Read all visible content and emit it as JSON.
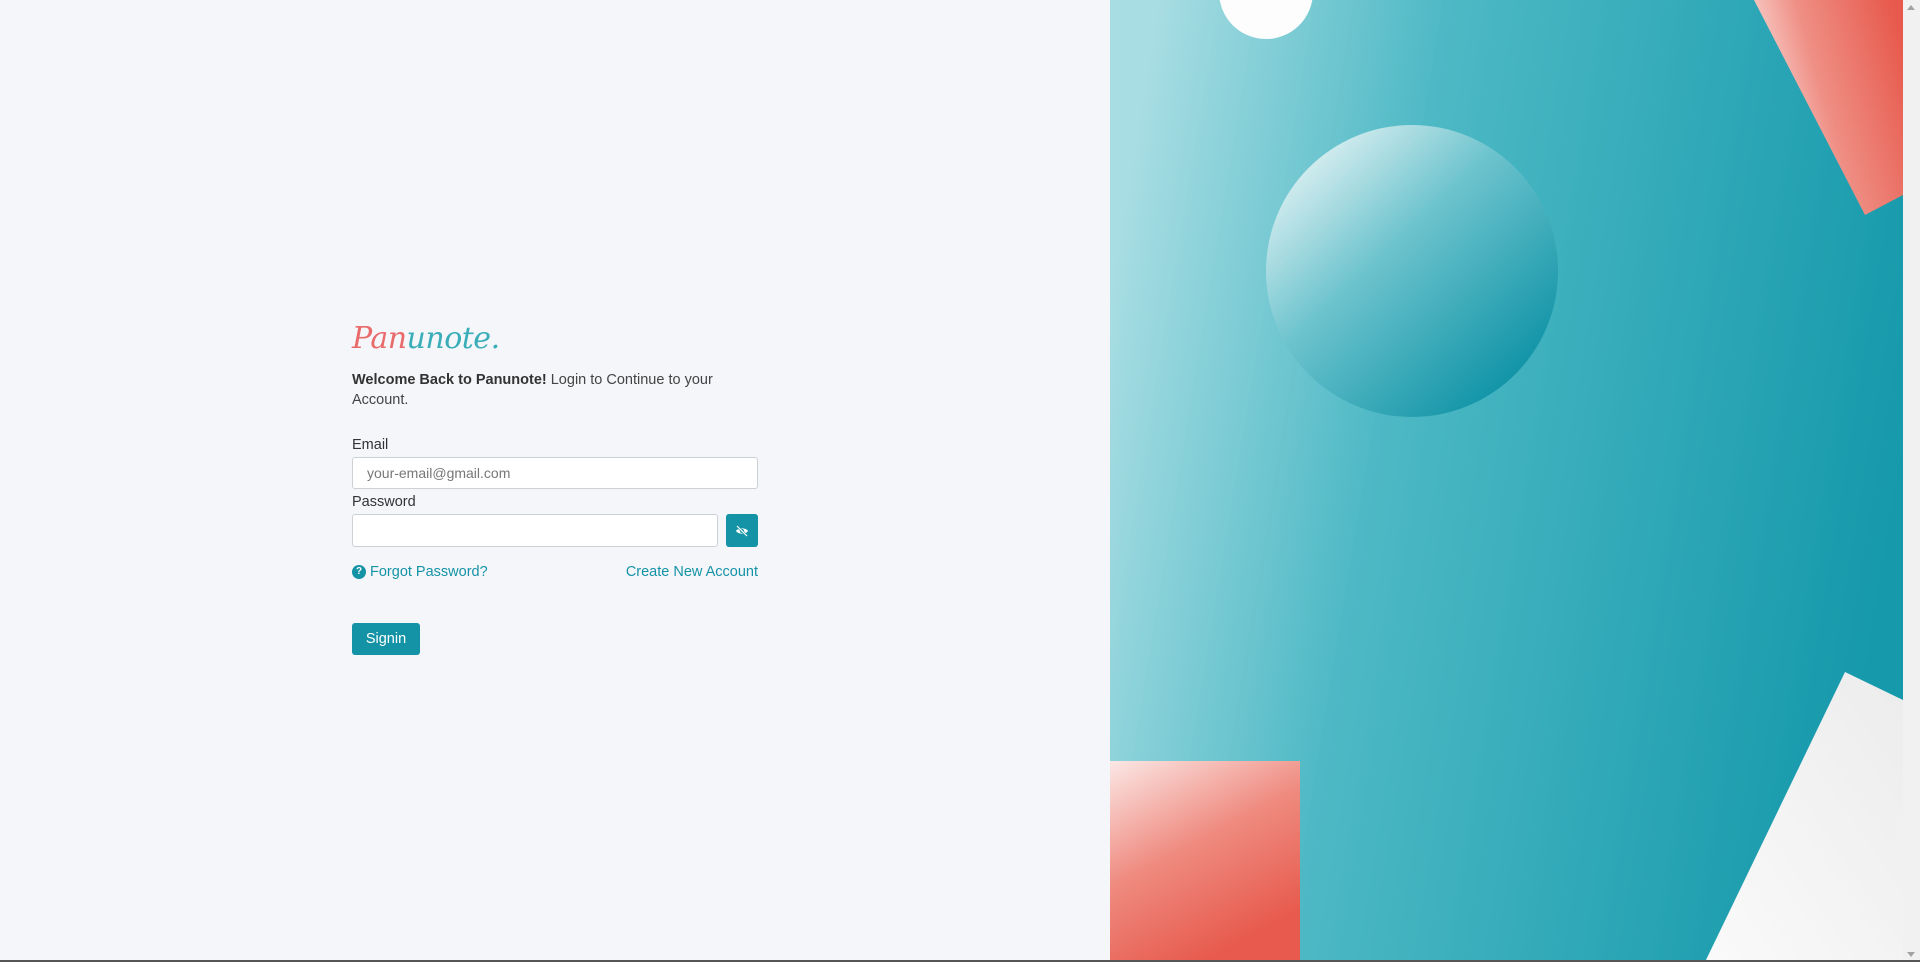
{
  "brand": {
    "logo_part1": "Pan",
    "logo_part2": "unote",
    "logo_dot": "."
  },
  "welcome": {
    "bold": "Welcome Back to Panunote!",
    "rest": " Login to Continue to your Account."
  },
  "email": {
    "label": "Email",
    "placeholder": "your-email@gmail.com",
    "value": ""
  },
  "password": {
    "label": "Password",
    "value": "",
    "toggle_icon": "eye-slash-icon"
  },
  "links": {
    "forgot": "Forgot Password?",
    "forgot_icon": "question-circle-icon",
    "create": "Create New Account"
  },
  "signin_label": "Signin",
  "colors": {
    "accent": "#1593a6",
    "coral": "#e9594b",
    "teal_bg": "#1b9fb0",
    "page_bg": "#f5f6fa"
  }
}
